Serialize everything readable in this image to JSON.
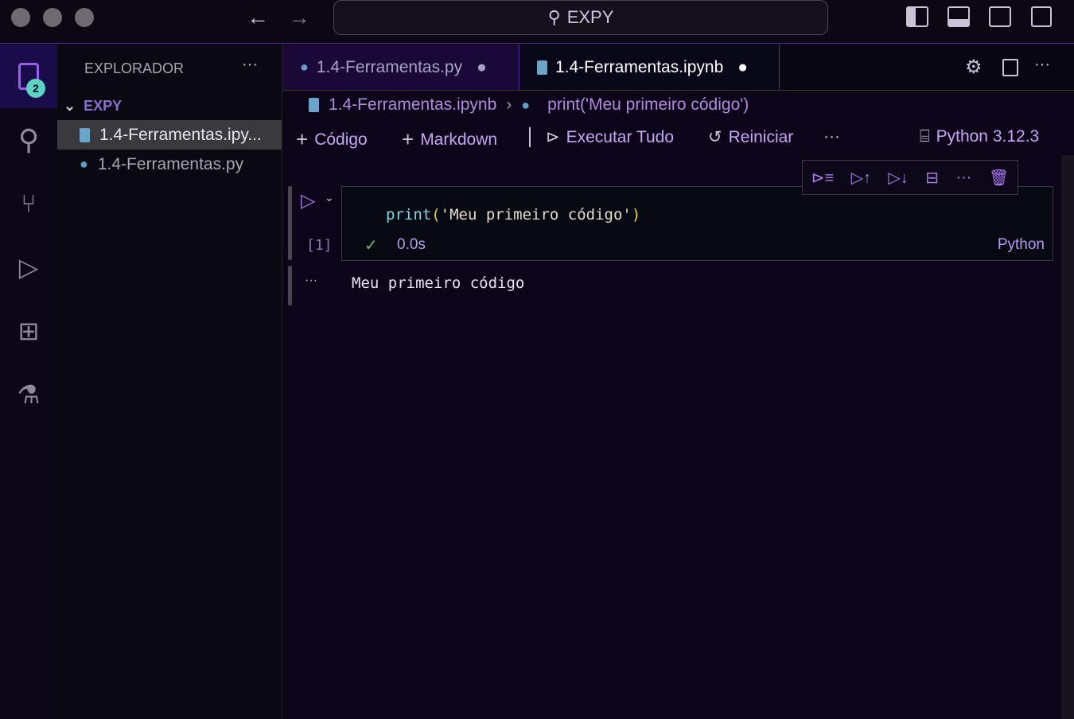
{
  "titlebar": {
    "search": "EXPY"
  },
  "activity": {
    "explorer_badge": "2"
  },
  "sidebar": {
    "title": "EXPLORADOR",
    "folder": "EXPY",
    "files": [
      "1.4-Ferramentas.ipy...",
      "1.4-Ferramentas.py"
    ]
  },
  "tabs": [
    {
      "label": "1.4-Ferramentas.py"
    },
    {
      "label": "1.4-Ferramentas.ipynb"
    }
  ],
  "breadcrumb": {
    "file": "1.4-Ferramentas.ipynb",
    "symbol": "print('Meu primeiro código')"
  },
  "toolbar": {
    "code": "Código",
    "markdown": "Markdown",
    "run_all": "Executar Tudo",
    "restart": "Reiniciar",
    "kernel": "Python 3.12.3"
  },
  "cell": {
    "code_fn": "print",
    "code_open": "(",
    "code_str": "'Meu primeiro código'",
    "code_close": ")",
    "exec_count": "[1]",
    "duration": "0.0s",
    "language": "Python",
    "output": "Meu primeiro código"
  },
  "colors": {
    "accent": "#c7a6f5",
    "background": "#0c0418"
  }
}
